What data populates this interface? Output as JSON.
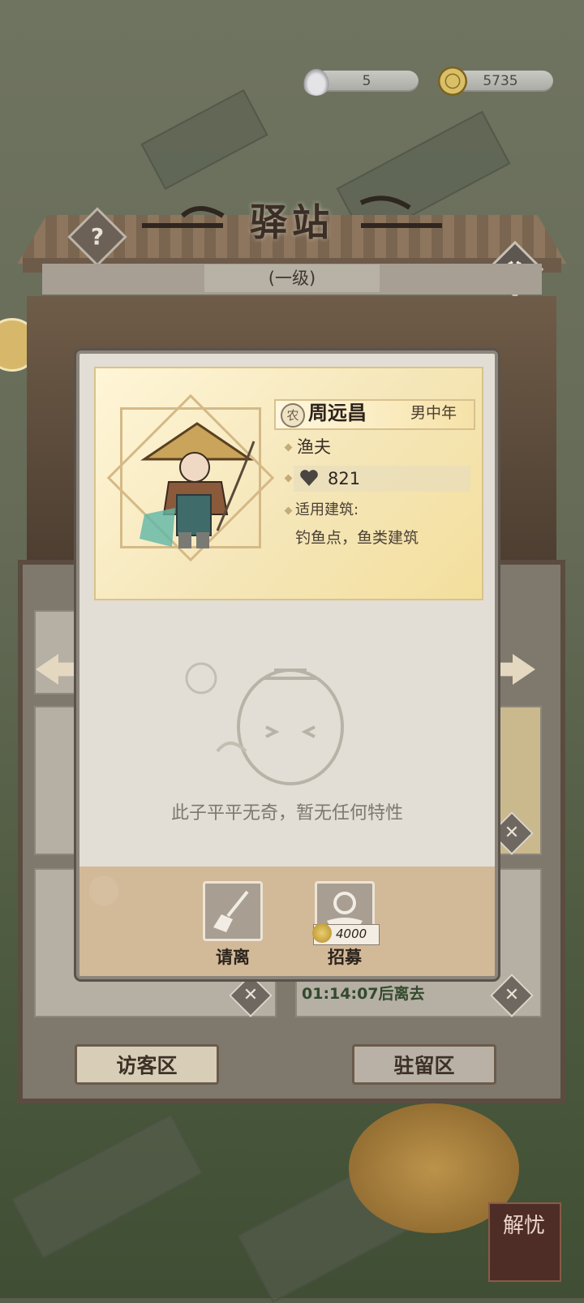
{
  "currency": {
    "silver": "5",
    "coins": "5735"
  },
  "building": {
    "title": "驿站",
    "level": "(一级)",
    "help_symbol": "?"
  },
  "visitor": {
    "category_badge": "农",
    "name": "周远昌",
    "tag": "男中年",
    "job": "渔夫",
    "power": "821",
    "building_label": "适用建筑:",
    "building_value": "钓鱼点，鱼类建筑",
    "trait": "此子平平无奇，暂无任何特性"
  },
  "actions": {
    "dismiss": "请离",
    "recruit": "招募",
    "recruit_cost": "4000"
  },
  "background": {
    "timer": "01:14:07后离去",
    "tab_visitor": "访客区",
    "tab_stay": "驻留区",
    "corner_button": "解忧"
  },
  "colors": {
    "card_bg": "#e2ded6",
    "head_gold": "#f5e6b8",
    "footer_tan": "#d2b998"
  },
  "icons": {
    "silver": "silver-ingot-icon",
    "coin": "copper-coin-icon",
    "power": "heart-fist-icon",
    "dismiss": "broom-icon",
    "recruit": "coin-hand-icon"
  }
}
